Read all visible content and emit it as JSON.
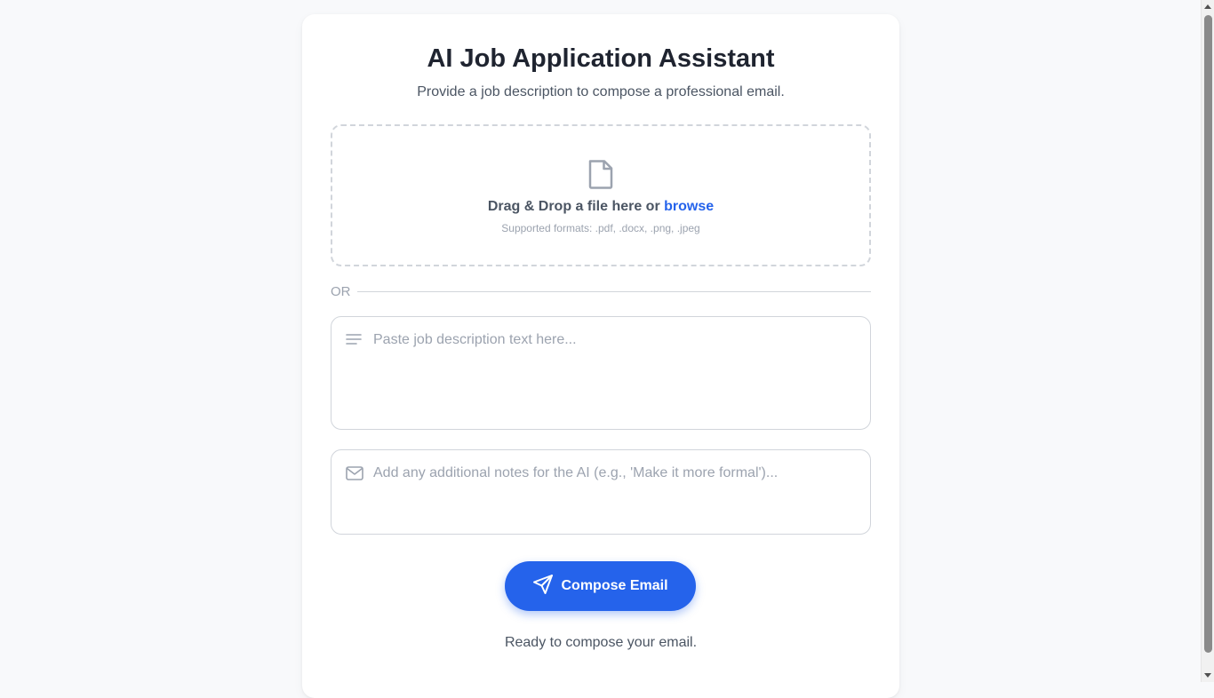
{
  "header": {
    "title": "AI Job Application Assistant",
    "subtitle": "Provide a job description to compose a professional email."
  },
  "upload": {
    "icon": "file-icon",
    "drop_text": "Drag & Drop a file here or ",
    "browse_label": "browse",
    "formats": "Supported formats: .pdf, .docx, .png, .jpeg"
  },
  "divider": {
    "label": "OR"
  },
  "job_description": {
    "icon": "text-lines-icon",
    "value": "",
    "placeholder": "Paste job description text here..."
  },
  "notes": {
    "icon": "mail-icon",
    "value": "",
    "placeholder": "Add any additional notes for the AI (e.g., 'Make it more formal')..."
  },
  "compose": {
    "icon": "send-icon",
    "label": "Compose Email"
  },
  "status": "Ready to compose your email.",
  "colors": {
    "accent": "#2563eb",
    "background": "#f8f9fb",
    "card": "#ffffff",
    "muted_text": "#9ca3af"
  }
}
